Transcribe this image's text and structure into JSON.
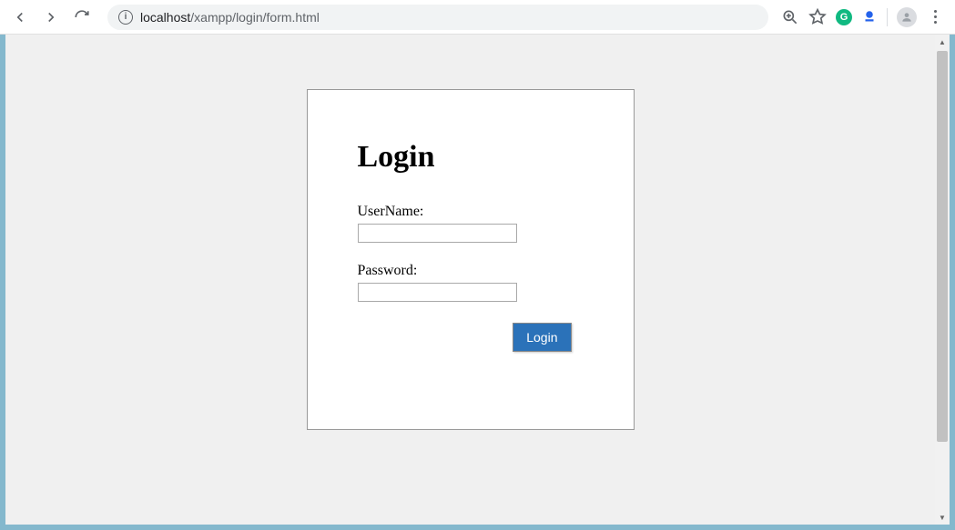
{
  "browser": {
    "url_host": "localhost",
    "url_path": "/xampp/login/form.html"
  },
  "form": {
    "title": "Login",
    "username_label": "UserName:",
    "username_value": "",
    "password_label": "Password:",
    "password_value": "",
    "submit_label": "Login"
  }
}
